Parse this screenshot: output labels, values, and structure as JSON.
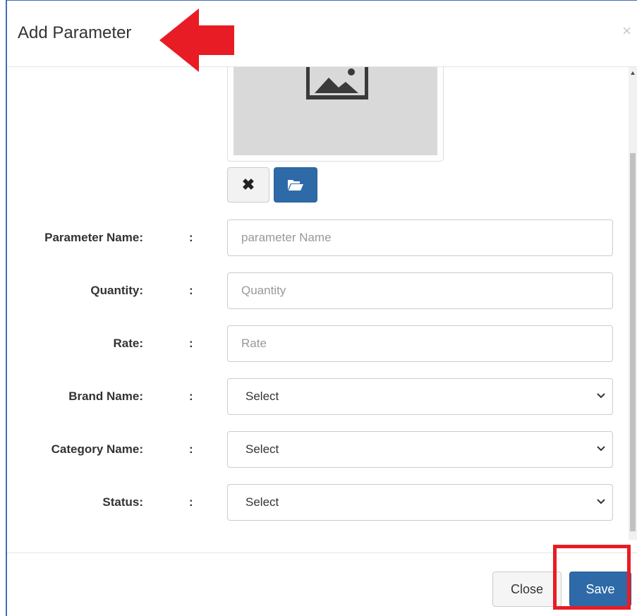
{
  "modal": {
    "title": "Add Parameter",
    "close_symbol": "×"
  },
  "image_upload": {
    "placeholder_icon": "image-placeholder-icon",
    "remove_icon": "times-icon",
    "remove_symbol": "✖",
    "browse_icon": "folder-open-icon"
  },
  "form": {
    "colon": ":",
    "parameter_name": {
      "label": "Parameter Name:",
      "placeholder": "parameter Name",
      "value": ""
    },
    "quantity": {
      "label": "Quantity:",
      "placeholder": "Quantity",
      "value": ""
    },
    "rate": {
      "label": "Rate:",
      "placeholder": "Rate",
      "value": ""
    },
    "brand_name": {
      "label": "Brand Name:",
      "selected": "Select"
    },
    "category_name": {
      "label": "Category Name:",
      "selected": "Select"
    },
    "status": {
      "label": "Status:",
      "selected": "Select"
    }
  },
  "footer": {
    "close_label": "Close",
    "save_label": "Save"
  },
  "annotations": {
    "arrow_color": "#e81c24",
    "highlight_color": "#e81c24"
  },
  "colors": {
    "primary": "#2f6aa8",
    "frame": "#3f6fb5"
  }
}
